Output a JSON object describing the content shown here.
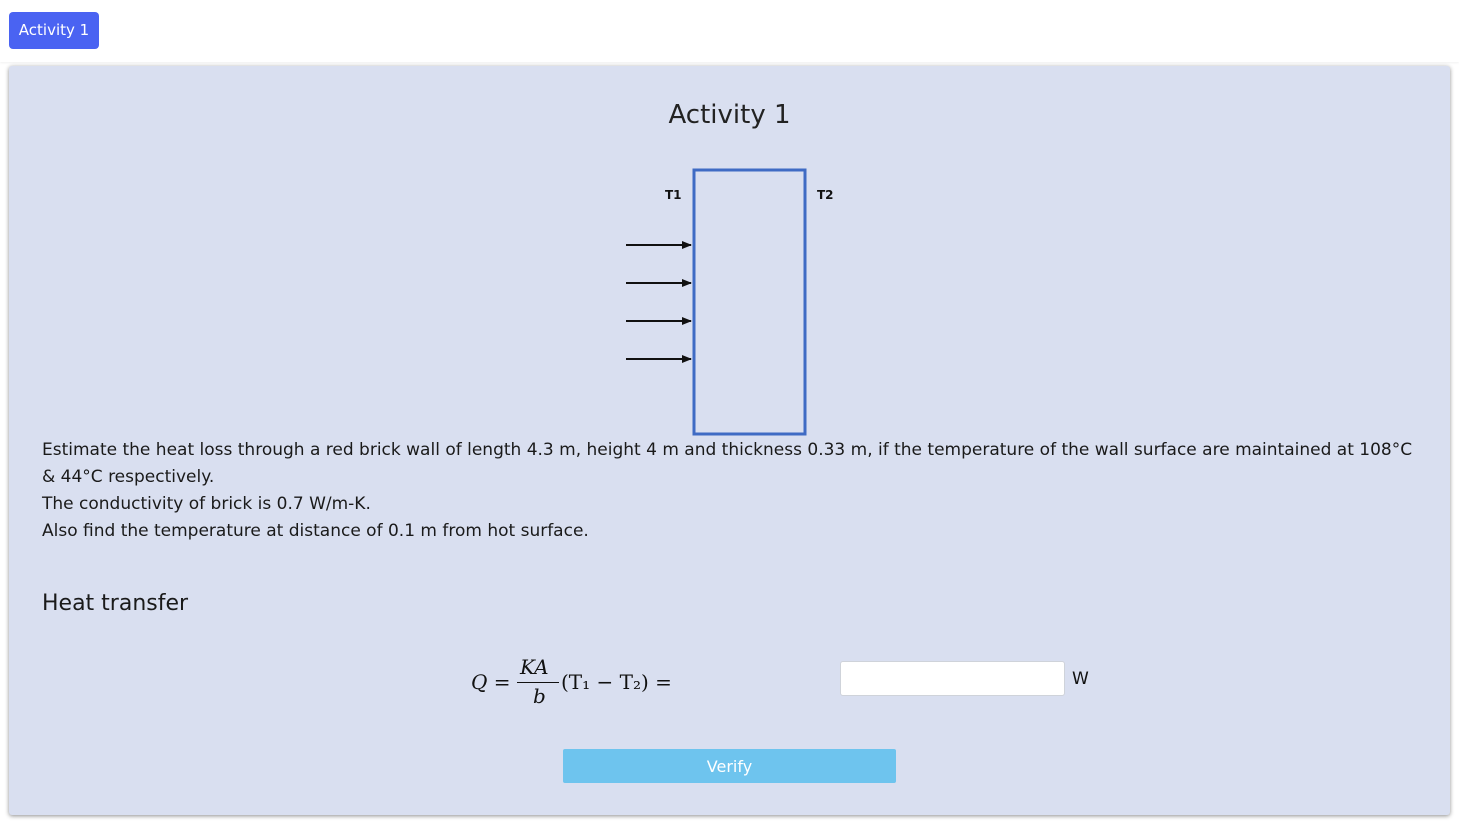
{
  "nav": {
    "tab_label": "Activity 1",
    "tab_color": "#4a63f2"
  },
  "panel": {
    "title": "Activity 1",
    "background": "#d9dff0"
  },
  "diagram": {
    "left_label": "T1",
    "right_label": "T2",
    "wall_color": "#3f6bc4",
    "arrow_count": 4
  },
  "problem": {
    "line1": "Estimate the heat loss through a red brick wall of length 4.3 m, height 4 m and thickness 0.33 m, if the temperature of the wall surface are maintained at 108°C & 44°C respectively.",
    "line2": "The conductivity of brick is 0.7 W/m-K.",
    "line3": "Also find the temperature at distance of 0.1 m from hot surface."
  },
  "section": {
    "heading": "Heat transfer"
  },
  "formula": {
    "lhs": "Q =",
    "numerator": "KA",
    "denominator": "b",
    "rhs": "(T₁ − T₂) ="
  },
  "answer": {
    "value": "",
    "placeholder": "",
    "unit": "W"
  },
  "verify": {
    "label": "Verify",
    "color": "#6ec4ee"
  }
}
